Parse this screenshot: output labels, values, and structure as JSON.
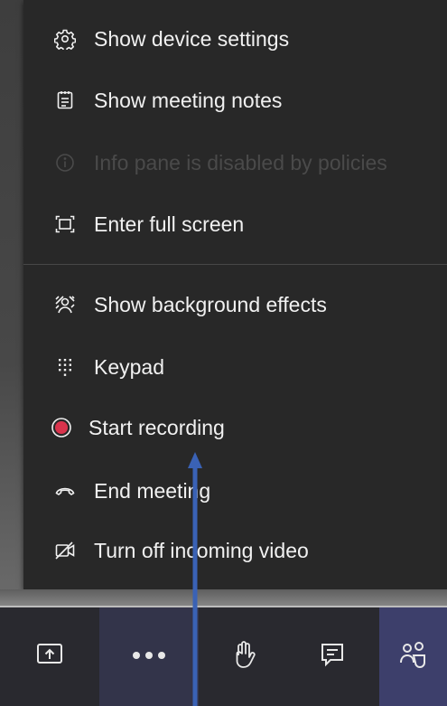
{
  "menu": {
    "items": [
      {
        "label": "Show device settings",
        "icon": "gear-icon",
        "enabled": true
      },
      {
        "label": "Show meeting notes",
        "icon": "notes-icon",
        "enabled": true
      },
      {
        "label": "Info pane is disabled by policies",
        "icon": "info-icon",
        "enabled": false
      },
      {
        "label": "Enter full screen",
        "icon": "fullscreen-icon",
        "enabled": true
      },
      {
        "label": "Show background effects",
        "icon": "background-effects-icon",
        "enabled": true
      },
      {
        "label": "Keypad",
        "icon": "keypad-icon",
        "enabled": true
      },
      {
        "label": "Start recording",
        "icon": "record-icon",
        "enabled": true
      },
      {
        "label": "End meeting",
        "icon": "hang-up-icon",
        "enabled": true
      },
      {
        "label": "Turn off incoming video",
        "icon": "video-off-icon",
        "enabled": true
      }
    ]
  },
  "toolbar": {
    "buttons": [
      {
        "icon": "share-tray-icon"
      },
      {
        "icon": "more-actions-icon"
      },
      {
        "icon": "raise-hand-icon"
      },
      {
        "icon": "chat-icon"
      },
      {
        "icon": "participants-icon"
      }
    ]
  },
  "colors": {
    "menu_bg": "#282828",
    "text": "#f1f1f1",
    "disabled_text": "#4a4a4a",
    "record_red": "#d9334c",
    "toolbar_bg": "#29292f",
    "annotation_arrow": "#3a62b5"
  }
}
